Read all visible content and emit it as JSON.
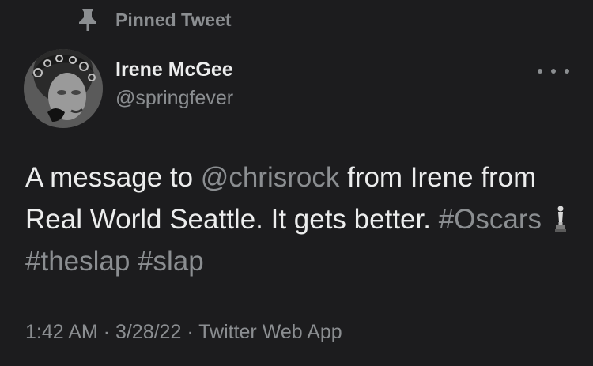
{
  "pinned": {
    "icon": "pin-icon",
    "label": "Pinned Tweet"
  },
  "author": {
    "avatar": "avatar",
    "display_name": "Irene McGee",
    "handle": "@springfever"
  },
  "more": {
    "icon": "more-options-icon"
  },
  "tweet": {
    "t1": "A message to ",
    "mention": "@chrisrock",
    "t2": " from Irene from Real World Seattle. It gets better. ",
    "hashtag1": "#Oscars",
    "emoji": "oscar-trophy-emoji",
    "hashtag2": "#theslap",
    "t3": " ",
    "hashtag3": "#slap"
  },
  "meta": {
    "time": "1:42 AM",
    "sep1": " · ",
    "date": "3/28/22",
    "sep2": " · ",
    "source": "Twitter Web App"
  },
  "colors": {
    "background": "#1c1c1e",
    "text": "#eceded",
    "secondary": "#8b8e91"
  }
}
